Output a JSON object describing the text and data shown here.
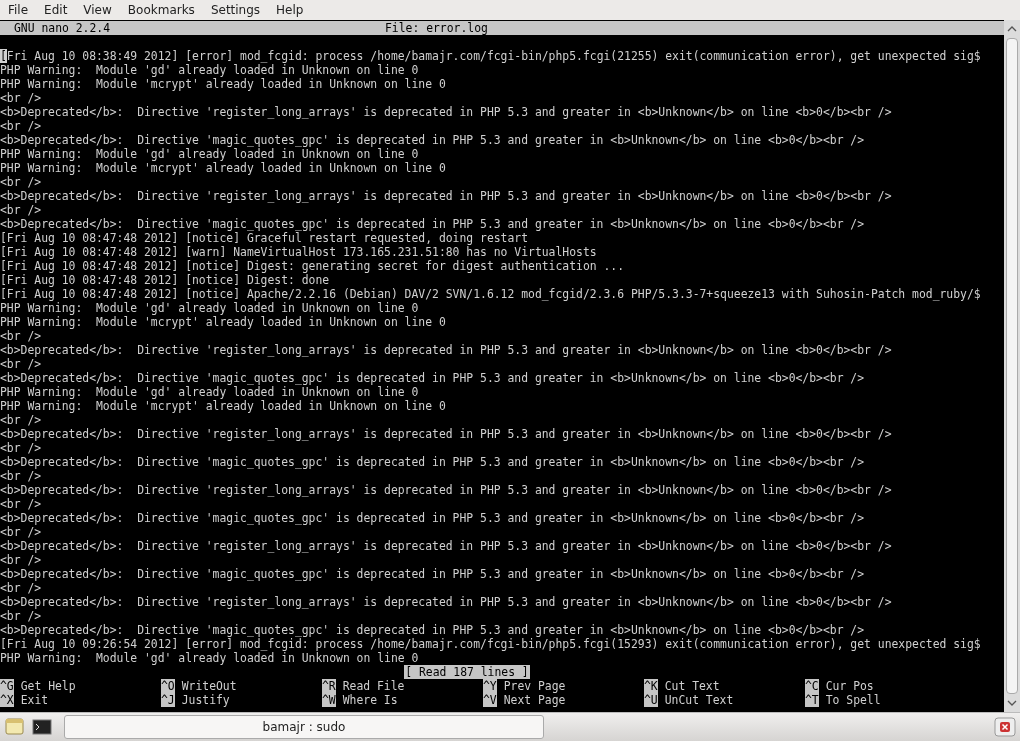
{
  "menu": [
    "File",
    "Edit",
    "View",
    "Bookmarks",
    "Settings",
    "Help"
  ],
  "titlebar": {
    "version": "GNU nano 2.2.4",
    "file": "File: error.log"
  },
  "lines": [
    {
      "text": "[Fri Aug 10 08:38:49 2012] [error] mod_fcgid: process /home/bamajr.com/fcgi-bin/php5.fcgi(21255) exit(communication error), get unexpected sig$",
      "cursor": true
    },
    {
      "text": "PHP Warning:  Module 'gd' already loaded in Unknown on line 0",
      "cursor": false
    },
    {
      "text": "PHP Warning:  Module 'mcrypt' already loaded in Unknown on line 0",
      "cursor": false
    },
    {
      "text": "<br />",
      "cursor": false
    },
    {
      "text": "<b>Deprecated</b>:  Directive 'register_long_arrays' is deprecated in PHP 5.3 and greater in <b>Unknown</b> on line <b>0</b><br />",
      "cursor": false
    },
    {
      "text": "<br />",
      "cursor": false
    },
    {
      "text": "<b>Deprecated</b>:  Directive 'magic_quotes_gpc' is deprecated in PHP 5.3 and greater in <b>Unknown</b> on line <b>0</b><br />",
      "cursor": false
    },
    {
      "text": "PHP Warning:  Module 'gd' already loaded in Unknown on line 0",
      "cursor": false
    },
    {
      "text": "PHP Warning:  Module 'mcrypt' already loaded in Unknown on line 0",
      "cursor": false
    },
    {
      "text": "<br />",
      "cursor": false
    },
    {
      "text": "<b>Deprecated</b>:  Directive 'register_long_arrays' is deprecated in PHP 5.3 and greater in <b>Unknown</b> on line <b>0</b><br />",
      "cursor": false
    },
    {
      "text": "<br />",
      "cursor": false
    },
    {
      "text": "<b>Deprecated</b>:  Directive 'magic_quotes_gpc' is deprecated in PHP 5.3 and greater in <b>Unknown</b> on line <b>0</b><br />",
      "cursor": false
    },
    {
      "text": "[Fri Aug 10 08:47:48 2012] [notice] Graceful restart requested, doing restart",
      "cursor": false
    },
    {
      "text": "[Fri Aug 10 08:47:48 2012] [warn] NameVirtualHost 173.165.231.51:80 has no VirtualHosts",
      "cursor": false
    },
    {
      "text": "[Fri Aug 10 08:47:48 2012] [notice] Digest: generating secret for digest authentication ...",
      "cursor": false
    },
    {
      "text": "[Fri Aug 10 08:47:48 2012] [notice] Digest: done",
      "cursor": false
    },
    {
      "text": "[Fri Aug 10 08:47:48 2012] [notice] Apache/2.2.16 (Debian) DAV/2 SVN/1.6.12 mod_fcgid/2.3.6 PHP/5.3.3-7+squeeze13 with Suhosin-Patch mod_ruby/$",
      "cursor": false
    },
    {
      "text": "PHP Warning:  Module 'gd' already loaded in Unknown on line 0",
      "cursor": false
    },
    {
      "text": "PHP Warning:  Module 'mcrypt' already loaded in Unknown on line 0",
      "cursor": false
    },
    {
      "text": "<br />",
      "cursor": false
    },
    {
      "text": "<b>Deprecated</b>:  Directive 'register_long_arrays' is deprecated in PHP 5.3 and greater in <b>Unknown</b> on line <b>0</b><br />",
      "cursor": false
    },
    {
      "text": "<br />",
      "cursor": false
    },
    {
      "text": "<b>Deprecated</b>:  Directive 'magic_quotes_gpc' is deprecated in PHP 5.3 and greater in <b>Unknown</b> on line <b>0</b><br />",
      "cursor": false
    },
    {
      "text": "PHP Warning:  Module 'gd' already loaded in Unknown on line 0",
      "cursor": false
    },
    {
      "text": "PHP Warning:  Module 'mcrypt' already loaded in Unknown on line 0",
      "cursor": false
    },
    {
      "text": "<br />",
      "cursor": false
    },
    {
      "text": "<b>Deprecated</b>:  Directive 'register_long_arrays' is deprecated in PHP 5.3 and greater in <b>Unknown</b> on line <b>0</b><br />",
      "cursor": false
    },
    {
      "text": "<br />",
      "cursor": false
    },
    {
      "text": "<b>Deprecated</b>:  Directive 'magic_quotes_gpc' is deprecated in PHP 5.3 and greater in <b>Unknown</b> on line <b>0</b><br />",
      "cursor": false
    },
    {
      "text": "<br />",
      "cursor": false
    },
    {
      "text": "<b>Deprecated</b>:  Directive 'register_long_arrays' is deprecated in PHP 5.3 and greater in <b>Unknown</b> on line <b>0</b><br />",
      "cursor": false
    },
    {
      "text": "<br />",
      "cursor": false
    },
    {
      "text": "<b>Deprecated</b>:  Directive 'magic_quotes_gpc' is deprecated in PHP 5.3 and greater in <b>Unknown</b> on line <b>0</b><br />",
      "cursor": false
    },
    {
      "text": "<br />",
      "cursor": false
    },
    {
      "text": "<b>Deprecated</b>:  Directive 'register_long_arrays' is deprecated in PHP 5.3 and greater in <b>Unknown</b> on line <b>0</b><br />",
      "cursor": false
    },
    {
      "text": "<br />",
      "cursor": false
    },
    {
      "text": "<b>Deprecated</b>:  Directive 'magic_quotes_gpc' is deprecated in PHP 5.3 and greater in <b>Unknown</b> on line <b>0</b><br />",
      "cursor": false
    },
    {
      "text": "<br />",
      "cursor": false
    },
    {
      "text": "<b>Deprecated</b>:  Directive 'register_long_arrays' is deprecated in PHP 5.3 and greater in <b>Unknown</b> on line <b>0</b><br />",
      "cursor": false
    },
    {
      "text": "<br />",
      "cursor": false
    },
    {
      "text": "<b>Deprecated</b>:  Directive 'magic_quotes_gpc' is deprecated in PHP 5.3 and greater in <b>Unknown</b> on line <b>0</b><br />",
      "cursor": false
    },
    {
      "text": "[Fri Aug 10 09:26:54 2012] [error] mod_fcgid: process /home/bamajr.com/fcgi-bin/php5.fcgi(15293) exit(communication error), get unexpected sig$",
      "cursor": false
    },
    {
      "text": "PHP Warning:  Module 'gd' already loaded in Unknown on line 0",
      "cursor": false
    }
  ],
  "status": "[ Read 187 lines ]",
  "shortcuts": [
    [
      {
        "key": "^G",
        "label": "Get Help"
      },
      {
        "key": "^O",
        "label": "WriteOut"
      },
      {
        "key": "^R",
        "label": "Read File"
      },
      {
        "key": "^Y",
        "label": "Prev Page"
      },
      {
        "key": "^K",
        "label": "Cut Text"
      },
      {
        "key": "^C",
        "label": "Cur Pos"
      }
    ],
    [
      {
        "key": "^X",
        "label": "Exit"
      },
      {
        "key": "^J",
        "label": "Justify"
      },
      {
        "key": "^W",
        "label": "Where Is"
      },
      {
        "key": "^V",
        "label": "Next Page"
      },
      {
        "key": "^U",
        "label": "UnCut Text"
      },
      {
        "key": "^T",
        "label": "To Spell"
      }
    ]
  ],
  "taskbar": {
    "task": "bamajr : sudo"
  }
}
